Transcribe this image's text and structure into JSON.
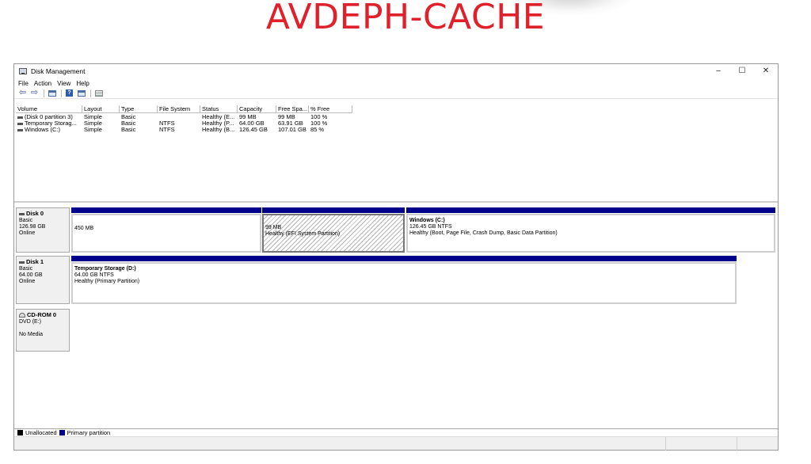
{
  "banner": {
    "title": "AVDEPH-CACHE"
  },
  "window": {
    "title": "Disk Management",
    "controls": {
      "minimize": "–",
      "maximize": "☐",
      "close": "✕"
    }
  },
  "menu": [
    "File",
    "Action",
    "View",
    "Help"
  ],
  "toolbar": {
    "icons": [
      "back-icon",
      "forward-icon",
      "volume-list-icon",
      "help-icon",
      "properties-icon",
      "list-view-icon"
    ],
    "back": "⇦",
    "forward": "⇨",
    "help": "?"
  },
  "volume_table": {
    "columns": [
      "Volume",
      "Layout",
      "Type",
      "File System",
      "Status",
      "Capacity",
      "Free Spa...",
      "% Free"
    ],
    "rows": [
      [
        "(Disk 0 partition 3)",
        "Simple",
        "Basic",
        "",
        "Healthy (E...",
        "99 MB",
        "99 MB",
        "100 %"
      ],
      [
        "Temporary Storag...",
        "Simple",
        "Basic",
        "NTFS",
        "Healthy (P...",
        "64.00 GB",
        "63.91 GB",
        "100 %"
      ],
      [
        "Windows (C:)",
        "Simple",
        "Basic",
        "NTFS",
        "Healthy (B...",
        "126.45 GB",
        "107.01 GB",
        "85 %"
      ]
    ]
  },
  "disks": {
    "disk0": {
      "name": "Disk 0",
      "type": "Basic",
      "size": "126.98 GB",
      "state": "Online",
      "partitions": [
        {
          "line1": "450 MB"
        },
        {
          "line1": "99 MB",
          "line2": "Healthy (EFI System Partition)"
        },
        {
          "title": "Windows  (C:)",
          "line1": "126.45 GB NTFS",
          "line2": "Healthy (Boot, Page File, Crash Dump, Basic Data Partition)"
        }
      ]
    },
    "disk1": {
      "name": "Disk 1",
      "type": "Basic",
      "size": "64.00 GB",
      "state": "Online",
      "partitions": [
        {
          "title": "Temporary Storage  (D:)",
          "line1": "64.00 GB NTFS",
          "line2": "Healthy (Primary Partition)"
        }
      ]
    },
    "cdrom0": {
      "name": "CD-ROM 0",
      "type": "DVD (E:)",
      "state": "No Media"
    }
  },
  "legend": [
    {
      "label": "Unallocated",
      "color": "#000000"
    },
    {
      "label": "Primary partition",
      "color": "#00008b"
    }
  ],
  "colors": {
    "primary_partition": "#00008b",
    "unallocated": "#000000",
    "banner": "#e0202a"
  }
}
